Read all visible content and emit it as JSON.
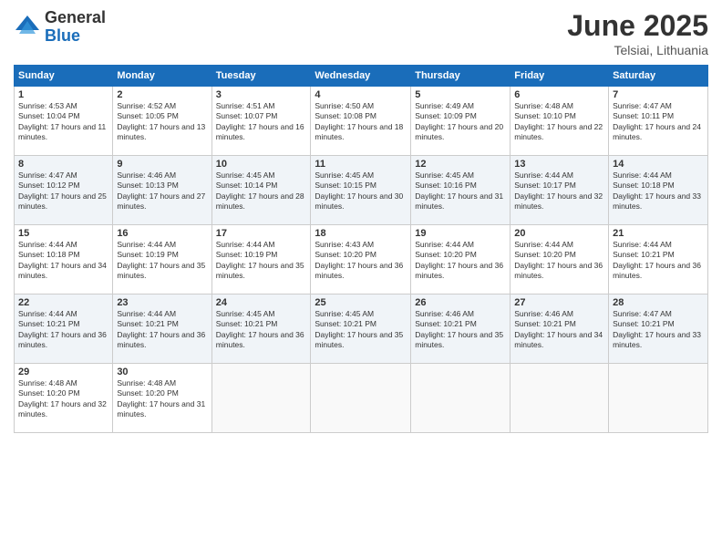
{
  "logo": {
    "general": "General",
    "blue": "Blue"
  },
  "title": {
    "month": "June 2025",
    "location": "Telsiai, Lithuania"
  },
  "header_days": [
    "Sunday",
    "Monday",
    "Tuesday",
    "Wednesday",
    "Thursday",
    "Friday",
    "Saturday"
  ],
  "weeks": [
    [
      {
        "day": "1",
        "sunrise": "Sunrise: 4:53 AM",
        "sunset": "Sunset: 10:04 PM",
        "daylight": "Daylight: 17 hours and 11 minutes."
      },
      {
        "day": "2",
        "sunrise": "Sunrise: 4:52 AM",
        "sunset": "Sunset: 10:05 PM",
        "daylight": "Daylight: 17 hours and 13 minutes."
      },
      {
        "day": "3",
        "sunrise": "Sunrise: 4:51 AM",
        "sunset": "Sunset: 10:07 PM",
        "daylight": "Daylight: 17 hours and 16 minutes."
      },
      {
        "day": "4",
        "sunrise": "Sunrise: 4:50 AM",
        "sunset": "Sunset: 10:08 PM",
        "daylight": "Daylight: 17 hours and 18 minutes."
      },
      {
        "day": "5",
        "sunrise": "Sunrise: 4:49 AM",
        "sunset": "Sunset: 10:09 PM",
        "daylight": "Daylight: 17 hours and 20 minutes."
      },
      {
        "day": "6",
        "sunrise": "Sunrise: 4:48 AM",
        "sunset": "Sunset: 10:10 PM",
        "daylight": "Daylight: 17 hours and 22 minutes."
      },
      {
        "day": "7",
        "sunrise": "Sunrise: 4:47 AM",
        "sunset": "Sunset: 10:11 PM",
        "daylight": "Daylight: 17 hours and 24 minutes."
      }
    ],
    [
      {
        "day": "8",
        "sunrise": "Sunrise: 4:47 AM",
        "sunset": "Sunset: 10:12 PM",
        "daylight": "Daylight: 17 hours and 25 minutes."
      },
      {
        "day": "9",
        "sunrise": "Sunrise: 4:46 AM",
        "sunset": "Sunset: 10:13 PM",
        "daylight": "Daylight: 17 hours and 27 minutes."
      },
      {
        "day": "10",
        "sunrise": "Sunrise: 4:45 AM",
        "sunset": "Sunset: 10:14 PM",
        "daylight": "Daylight: 17 hours and 28 minutes."
      },
      {
        "day": "11",
        "sunrise": "Sunrise: 4:45 AM",
        "sunset": "Sunset: 10:15 PM",
        "daylight": "Daylight: 17 hours and 30 minutes."
      },
      {
        "day": "12",
        "sunrise": "Sunrise: 4:45 AM",
        "sunset": "Sunset: 10:16 PM",
        "daylight": "Daylight: 17 hours and 31 minutes."
      },
      {
        "day": "13",
        "sunrise": "Sunrise: 4:44 AM",
        "sunset": "Sunset: 10:17 PM",
        "daylight": "Daylight: 17 hours and 32 minutes."
      },
      {
        "day": "14",
        "sunrise": "Sunrise: 4:44 AM",
        "sunset": "Sunset: 10:18 PM",
        "daylight": "Daylight: 17 hours and 33 minutes."
      }
    ],
    [
      {
        "day": "15",
        "sunrise": "Sunrise: 4:44 AM",
        "sunset": "Sunset: 10:18 PM",
        "daylight": "Daylight: 17 hours and 34 minutes."
      },
      {
        "day": "16",
        "sunrise": "Sunrise: 4:44 AM",
        "sunset": "Sunset: 10:19 PM",
        "daylight": "Daylight: 17 hours and 35 minutes."
      },
      {
        "day": "17",
        "sunrise": "Sunrise: 4:44 AM",
        "sunset": "Sunset: 10:19 PM",
        "daylight": "Daylight: 17 hours and 35 minutes."
      },
      {
        "day": "18",
        "sunrise": "Sunrise: 4:43 AM",
        "sunset": "Sunset: 10:20 PM",
        "daylight": "Daylight: 17 hours and 36 minutes."
      },
      {
        "day": "19",
        "sunrise": "Sunrise: 4:44 AM",
        "sunset": "Sunset: 10:20 PM",
        "daylight": "Daylight: 17 hours and 36 minutes."
      },
      {
        "day": "20",
        "sunrise": "Sunrise: 4:44 AM",
        "sunset": "Sunset: 10:20 PM",
        "daylight": "Daylight: 17 hours and 36 minutes."
      },
      {
        "day": "21",
        "sunrise": "Sunrise: 4:44 AM",
        "sunset": "Sunset: 10:21 PM",
        "daylight": "Daylight: 17 hours and 36 minutes."
      }
    ],
    [
      {
        "day": "22",
        "sunrise": "Sunrise: 4:44 AM",
        "sunset": "Sunset: 10:21 PM",
        "daylight": "Daylight: 17 hours and 36 minutes."
      },
      {
        "day": "23",
        "sunrise": "Sunrise: 4:44 AM",
        "sunset": "Sunset: 10:21 PM",
        "daylight": "Daylight: 17 hours and 36 minutes."
      },
      {
        "day": "24",
        "sunrise": "Sunrise: 4:45 AM",
        "sunset": "Sunset: 10:21 PM",
        "daylight": "Daylight: 17 hours and 36 minutes."
      },
      {
        "day": "25",
        "sunrise": "Sunrise: 4:45 AM",
        "sunset": "Sunset: 10:21 PM",
        "daylight": "Daylight: 17 hours and 35 minutes."
      },
      {
        "day": "26",
        "sunrise": "Sunrise: 4:46 AM",
        "sunset": "Sunset: 10:21 PM",
        "daylight": "Daylight: 17 hours and 35 minutes."
      },
      {
        "day": "27",
        "sunrise": "Sunrise: 4:46 AM",
        "sunset": "Sunset: 10:21 PM",
        "daylight": "Daylight: 17 hours and 34 minutes."
      },
      {
        "day": "28",
        "sunrise": "Sunrise: 4:47 AM",
        "sunset": "Sunset: 10:21 PM",
        "daylight": "Daylight: 17 hours and 33 minutes."
      }
    ],
    [
      {
        "day": "29",
        "sunrise": "Sunrise: 4:48 AM",
        "sunset": "Sunset: 10:20 PM",
        "daylight": "Daylight: 17 hours and 32 minutes."
      },
      {
        "day": "30",
        "sunrise": "Sunrise: 4:48 AM",
        "sunset": "Sunset: 10:20 PM",
        "daylight": "Daylight: 17 hours and 31 minutes."
      },
      null,
      null,
      null,
      null,
      null
    ]
  ]
}
